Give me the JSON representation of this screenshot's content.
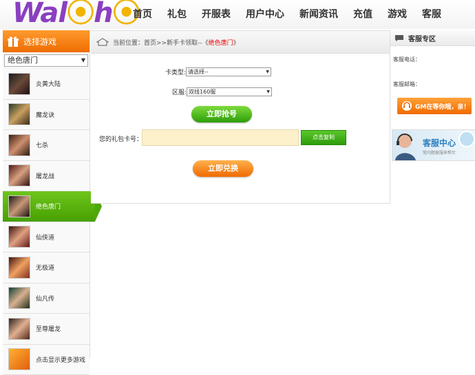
{
  "logo": {
    "text_a": "Wa",
    "text_b": "l",
    "text_c": "h",
    "text_d": "h"
  },
  "nav": [
    "首页",
    "礼包",
    "开服表",
    "用户中心",
    "新闻资讯",
    "充值",
    "游戏",
    "客服"
  ],
  "sidebar": {
    "title": "选择游戏",
    "selected_game": "绝色唐门",
    "games": [
      {
        "name": "炎黄大陆",
        "active": false
      },
      {
        "name": "魔龙诀",
        "active": false
      },
      {
        "name": "七杀",
        "active": false
      },
      {
        "name": "屠龙战",
        "active": false
      },
      {
        "name": "绝色唐门",
        "active": true
      },
      {
        "name": "仙侠道",
        "active": false
      },
      {
        "name": "无极道",
        "active": false
      },
      {
        "name": "仙凡传",
        "active": false
      },
      {
        "name": "至尊屠龙",
        "active": false
      },
      {
        "name": "点击显示更多游戏",
        "active": false
      }
    ]
  },
  "breadcrumb": {
    "prefix": "当前位置：首页>>新手卡领取--《",
    "highlight": "绝色唐门",
    "suffix": "》"
  },
  "form": {
    "card_type_label": "卡类型:",
    "card_type_value": "请选择--",
    "server_label": "区服:",
    "server_value": "双线160服",
    "grab_button": "立即抢号",
    "code_label": "您的礼包卡号：",
    "copy_button": "点击复制",
    "redeem_button": "立即兑换"
  },
  "support": {
    "title": "客服专区",
    "phone_label": "客服电话：",
    "email_label": "客服邮箱：",
    "gm_button": "GM在等你哦，亲！",
    "center_title": "客服中心",
    "center_sub": "常问题客服来帮忙"
  },
  "colors": {
    "accent_orange": "#ef6a00",
    "accent_green": "#46a000",
    "highlight_red": "#e00000"
  }
}
